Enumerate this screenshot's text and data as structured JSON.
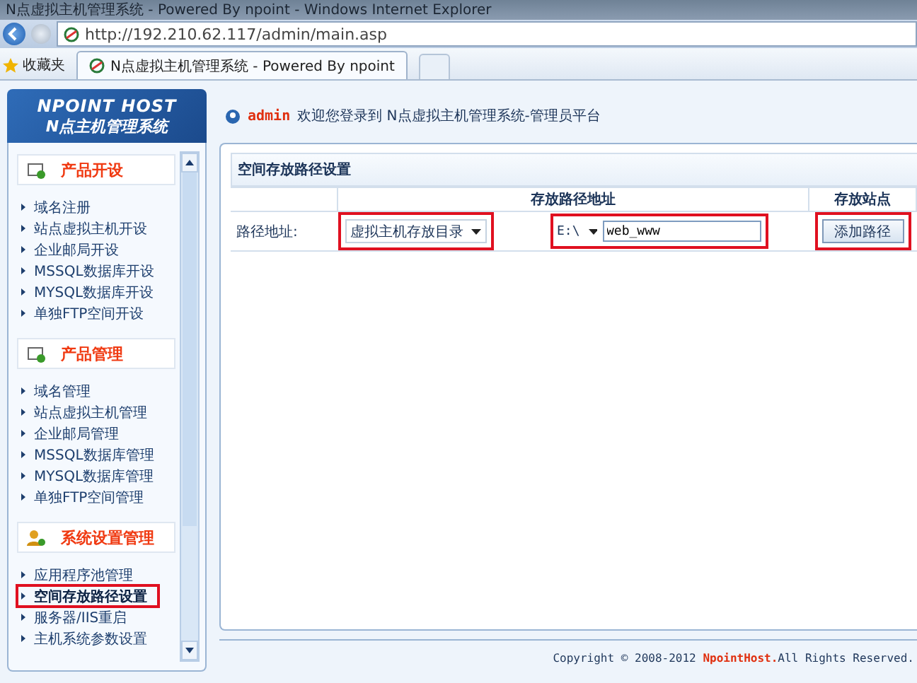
{
  "browser": {
    "title": "N点虚拟主机管理系统 - Powered By npoint - Windows Internet Explorer",
    "url": "http://192.210.62.117/admin/main.asp",
    "favorites": "收藏夹",
    "tab": "N点虚拟主机管理系统 - Powered By npoint"
  },
  "logo": {
    "line1": "NPOINT HOST",
    "line2": "N点主机管理系统"
  },
  "sidebar": {
    "sections": [
      {
        "title": "产品开设",
        "kind": "box",
        "items": [
          {
            "label": "域名注册",
            "selected": false
          },
          {
            "label": "站点虚拟主机开设",
            "selected": false
          },
          {
            "label": "企业邮局开设",
            "selected": false
          },
          {
            "label": "MSSQL数据库开设",
            "selected": false
          },
          {
            "label": "MYSQL数据库开设",
            "selected": false
          },
          {
            "label": "单独FTP空间开设",
            "selected": false
          }
        ]
      },
      {
        "title": "产品管理",
        "kind": "box",
        "items": [
          {
            "label": "域名管理",
            "selected": false
          },
          {
            "label": "站点虚拟主机管理",
            "selected": false
          },
          {
            "label": "企业邮局管理",
            "selected": false
          },
          {
            "label": "MSSQL数据库管理",
            "selected": false
          },
          {
            "label": "MYSQL数据库管理",
            "selected": false
          },
          {
            "label": "单独FTP空间管理",
            "selected": false
          }
        ]
      },
      {
        "title": "系统设置管理",
        "kind": "users",
        "items": [
          {
            "label": "应用程序池管理",
            "selected": false
          },
          {
            "label": "空间存放路径设置",
            "selected": true
          },
          {
            "label": "服务器/IIS重启",
            "selected": false
          },
          {
            "label": "主机系统参数设置",
            "selected": false
          }
        ]
      }
    ]
  },
  "header": {
    "user": "admin",
    "welcome": "欢迎您登录到 N点虚拟主机管理系统-管理员平台"
  },
  "panel": {
    "title": "空间存放路径设置",
    "columns": [
      "存放路径地址",
      "存放站点"
    ],
    "row": {
      "label": "路径地址:",
      "dir_select": {
        "value": "虚拟主机存放目录",
        "highlighted": true
      },
      "path": {
        "drive": "E:\\",
        "value": "web_www",
        "highlighted": true
      },
      "button": {
        "label": "添加路径",
        "highlighted": true
      }
    }
  },
  "footer": {
    "prefix": "Copyright © 2008-2012",
    "brand": "NpointHost.",
    "suffix": "All Rights Reserved."
  }
}
